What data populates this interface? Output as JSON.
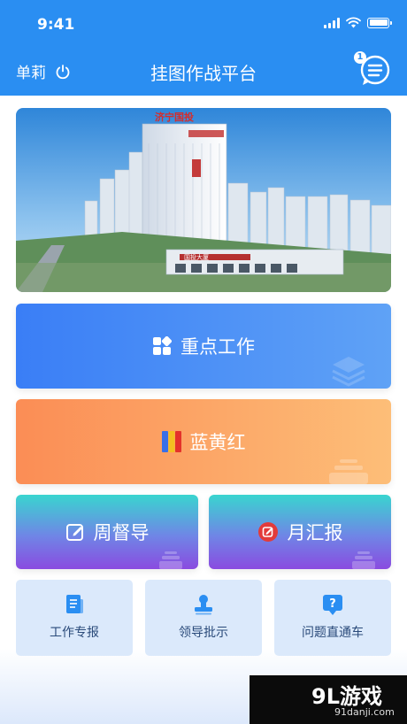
{
  "status_bar": {
    "time": "9:41"
  },
  "header": {
    "user_name": "单莉",
    "title": "挂图作战平台",
    "message_badge": "1"
  },
  "banner": {
    "sign_text": "济宁国投",
    "building_sign": "国投大厦"
  },
  "cards": {
    "key_work": "重点工作",
    "blue_yellow_red": "蓝黄红",
    "weekly_supervision": "周督导",
    "monthly_report": "月汇报"
  },
  "shortcuts": [
    {
      "label": "工作专报",
      "icon": "document-icon"
    },
    {
      "label": "领导批示",
      "icon": "stamp-icon"
    },
    {
      "label": "问题直通车",
      "icon": "question-icon"
    }
  ],
  "watermark": {
    "main": "9L游戏",
    "sub": "91danji.com"
  },
  "colors": {
    "header": "#2a8ef2",
    "key_work_card": "#3a7ef6",
    "blue_yellow_red_card": "#fb8d55",
    "purple_cards": "#8a4be0",
    "shortcut_bg": "#dbe9fb"
  }
}
